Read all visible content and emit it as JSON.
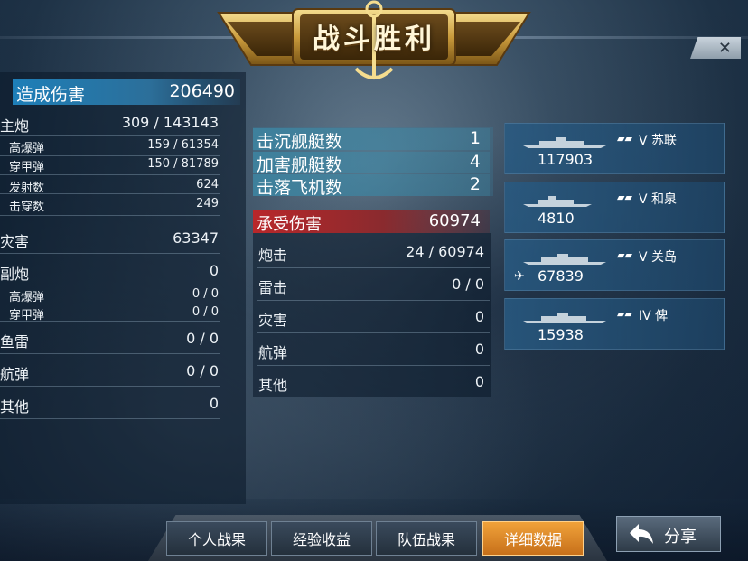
{
  "banner": {
    "title": "战斗胜利"
  },
  "close": {
    "icon": "close-icon"
  },
  "damage_dealt": {
    "label": "造成伤害",
    "value": "206490"
  },
  "left_stats": [
    {
      "label": "主炮",
      "value": "309 / 143143",
      "kind": "big"
    },
    {
      "label": "高爆弹",
      "value": "159 / 61354",
      "kind": "sub"
    },
    {
      "label": "穿甲弹",
      "value": "150 / 81789",
      "kind": "sub"
    },
    {
      "label": "发射数",
      "value": "624",
      "kind": "sub"
    },
    {
      "label": "击穿数",
      "value": "249",
      "kind": "sub"
    },
    {
      "label": "灾害",
      "value": "63347",
      "kind": "big"
    },
    {
      "label": "副炮",
      "value": "0",
      "kind": "big"
    },
    {
      "label": "高爆弹",
      "value": "0 / 0",
      "kind": "sub"
    },
    {
      "label": "穿甲弹",
      "value": "0 / 0",
      "kind": "sub"
    },
    {
      "label": "鱼雷",
      "value": "0 / 0",
      "kind": "big"
    },
    {
      "label": "航弹",
      "value": "0 / 0",
      "kind": "big"
    },
    {
      "label": "其他",
      "value": "0",
      "kind": "big"
    }
  ],
  "kills": [
    {
      "label": "击沉舰艇数",
      "value": "1"
    },
    {
      "label": "加害舰艇数",
      "value": "4"
    },
    {
      "label": "击落飞机数",
      "value": "2"
    }
  ],
  "damage_received": {
    "label": "承受伤害",
    "value": "60974"
  },
  "received_stats": [
    {
      "label": "炮击",
      "value": "24 / 60974"
    },
    {
      "label": "雷击",
      "value": "0 / 0"
    },
    {
      "label": "灾害",
      "value": "0"
    },
    {
      "label": "航弹",
      "value": "0"
    },
    {
      "label": "其他",
      "value": "0"
    }
  ],
  "team": [
    {
      "tier": "V",
      "name": "苏联",
      "damage": "117903",
      "has_plane": false
    },
    {
      "tier": "V",
      "name": "和泉",
      "damage": "4810",
      "has_plane": false
    },
    {
      "tier": "V",
      "name": "关岛",
      "damage": "67839",
      "has_plane": true
    },
    {
      "tier": "IV",
      "name": "俾",
      "damage": "15938",
      "has_plane": false
    }
  ],
  "tabs": [
    {
      "label": "个人战果",
      "active": false
    },
    {
      "label": "经验收益",
      "active": false
    },
    {
      "label": "队伍战果",
      "active": false
    },
    {
      "label": "详细数据",
      "active": true
    }
  ],
  "share": {
    "label": "分享",
    "icon": "share-arrow-icon"
  },
  "colors": {
    "accent_blue": "#1e7fb8",
    "received_red": "#b8272a",
    "active_tab": "#f0a23a"
  }
}
